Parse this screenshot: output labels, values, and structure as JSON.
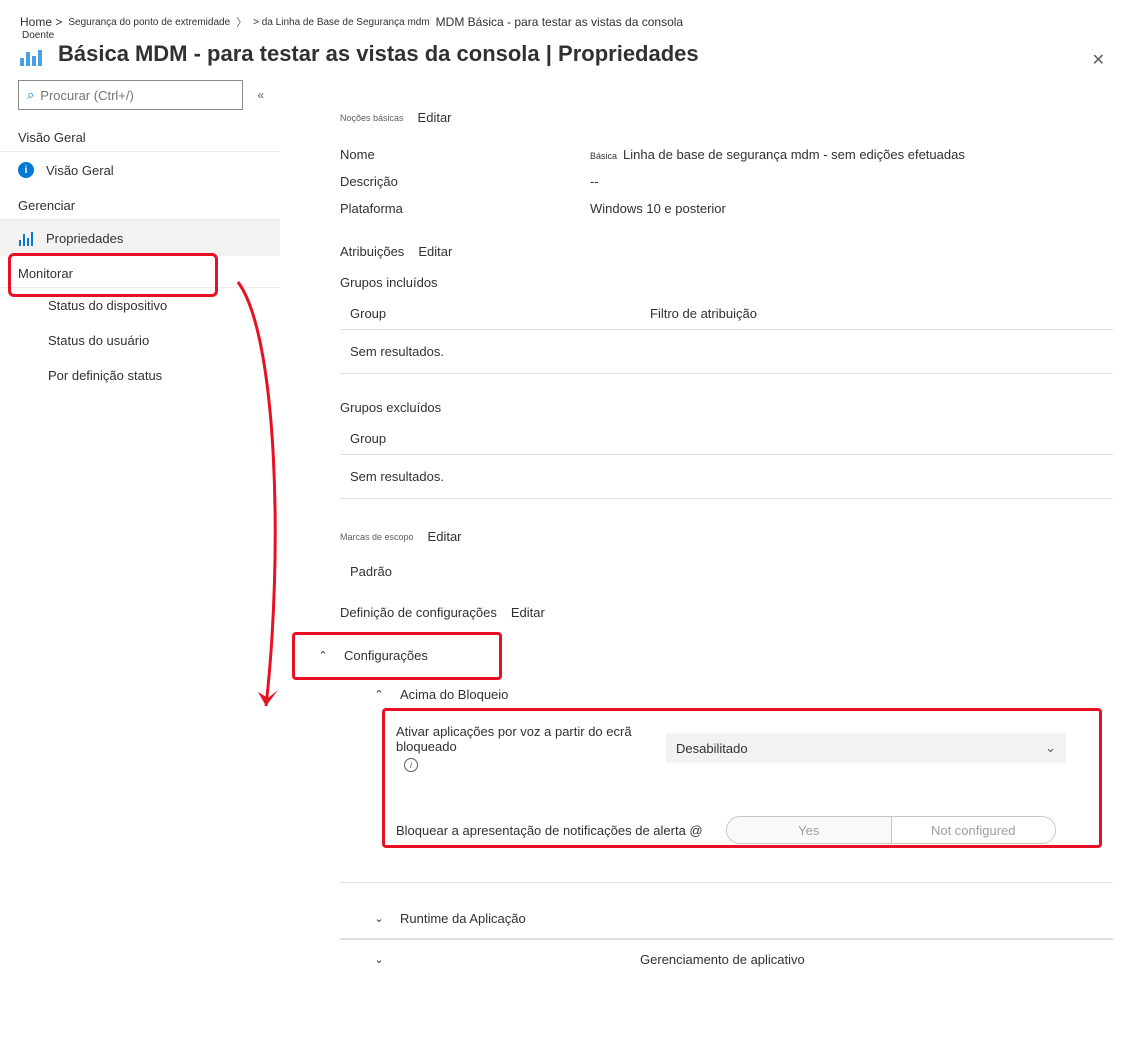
{
  "breadcrumb": {
    "home": "Home >",
    "endpoint_sec": "Segurança do ponto de extremidade",
    "mdm_baseline": "> da Linha de Base de Segurança mdm",
    "current": "MDM Básica - para testar as vistas da consola"
  },
  "title": {
    "small_label": "Doente",
    "main": "MDM - para testar as vistas da consola | Propriedades",
    "prefix": "Básica"
  },
  "sidebar": {
    "search_placeholder": "Procurar (Ctrl+/)",
    "sections": {
      "overview_header": "Visão Geral",
      "overview_item": "Visão Geral",
      "manage_header": "Gerenciar",
      "properties_item": "Propriedades",
      "monitor_header": "Monitorar",
      "device_status": "Status do dispositivo",
      "user_status": "Status do usuário",
      "per_setting_status": "Por definição status"
    }
  },
  "main": {
    "basics": {
      "tiny": "Noções básicas",
      "edit": "Editar"
    },
    "kv": {
      "name_key": "Nome",
      "name_tiny": "Básica",
      "name_val": "Linha de base de segurança mdm - sem edições efetuadas",
      "desc_key": "Descrição",
      "desc_val": "--",
      "platform_key": "Plataforma",
      "platform_val": "Windows 10 e posterior"
    },
    "assignments": {
      "label": "Atribuições",
      "edit": "Editar"
    },
    "included": {
      "header": "Grupos incluídos",
      "col1": "Group",
      "col2": "Filtro de atribuição",
      "empty": "Sem resultados."
    },
    "excluded": {
      "header": "Grupos excluídos",
      "col1": "Group",
      "empty": "Sem resultados."
    },
    "scope": {
      "tiny": "Marcas de escopo",
      "edit": "Editar",
      "value": "Padrão"
    },
    "config_def": {
      "label": "Definição de configurações",
      "edit": "Editar"
    },
    "configs_header": "Configurações",
    "above_lock": {
      "header": "Acima do Bloqueio",
      "voice_label": "Ativar aplicações por voz a partir do ecrã bloqueado",
      "voice_value": "Desabilitado",
      "toast_label": "Bloquear a apresentação de notificações de alerta @",
      "opt_yes": "Yes",
      "opt_not": "Not configured"
    },
    "app_runtime": "Runtime da Aplicação",
    "app_management": "Gerenciamento de aplicativo"
  }
}
